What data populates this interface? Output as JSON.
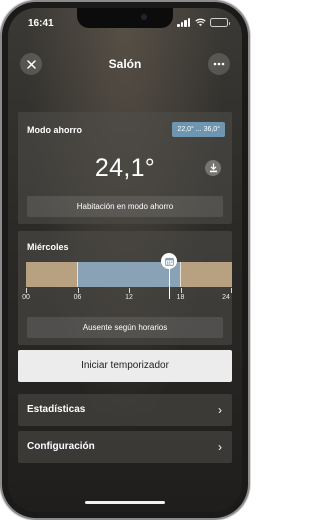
{
  "status_bar": {
    "time": "16:41",
    "battery_level": 0.85
  },
  "header": {
    "title": "Salón",
    "close_icon": "close-icon",
    "more_icon": "more-icon"
  },
  "mode_card": {
    "label": "Modo ahorro",
    "range": "22,0° ... 36,0°",
    "temperature": "24,1°",
    "eco_icon": "eco-download-icon",
    "status": "Habitación en modo ahorro"
  },
  "schedule_card": {
    "day": "Miércoles",
    "ticks": [
      "00",
      "06",
      "12",
      "18",
      "24"
    ],
    "current_hour": 16.7,
    "segments": [
      {
        "from": 0,
        "to": 6,
        "type": "presence",
        "color": "#b8a180"
      },
      {
        "from": 6,
        "to": 18,
        "type": "absent",
        "color": "#8aa2b5"
      },
      {
        "from": 18,
        "to": 24,
        "type": "presence",
        "color": "#b8a180"
      }
    ],
    "status": "Ausente según horarios"
  },
  "actions": {
    "start_timer": "Iniciar temporizador"
  },
  "menu": {
    "items": [
      {
        "label": "Estadísticas"
      },
      {
        "label": "Configuración"
      }
    ]
  },
  "colors": {
    "range_badge": "#6e96b0",
    "presence": "#b8a180",
    "absent": "#8aa2b5"
  }
}
